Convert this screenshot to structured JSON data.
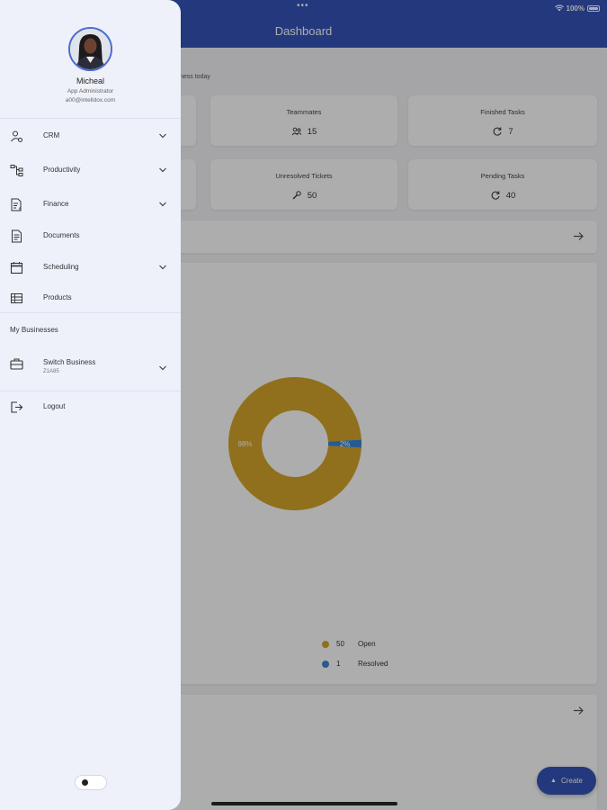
{
  "status_bar": {
    "battery": "100%"
  },
  "header": {
    "title": "Dashboard"
  },
  "dashboard": {
    "subtitle_fragment": "ness today",
    "stats": [
      {
        "label": "Teammates",
        "value": "15",
        "icon": "users-icon"
      },
      {
        "label": "Finished Tasks",
        "value": "7",
        "icon": "refresh-icon"
      },
      {
        "label": "Unresolved Tickets",
        "value": "50",
        "icon": "wrench-icon"
      },
      {
        "label": "Pending Tasks",
        "value": "40",
        "icon": "refresh-icon"
      }
    ],
    "chart_data": {
      "type": "pie",
      "donut": true,
      "slices": [
        {
          "label": "Open",
          "value": 50,
          "percent_label": "98%",
          "color": "#d4a62a"
        },
        {
          "label": "Resolved",
          "value": 1,
          "percent_label": "2%",
          "color": "#3a86d4"
        }
      ],
      "legend_position": "bottom"
    },
    "legend": [
      {
        "count": "50",
        "label": "Open",
        "color": "#d4a62a"
      },
      {
        "count": "1",
        "label": "Resolved",
        "color": "#3a86d4"
      }
    ]
  },
  "fab": {
    "label": "Create"
  },
  "drawer": {
    "user": {
      "name": "Micheal",
      "role": "App Administrator",
      "email": "a00@intelldox.com"
    },
    "menu": [
      {
        "label": "CRM",
        "icon": "crm-icon",
        "expandable": true
      },
      {
        "label": "Productivity",
        "icon": "productivity-icon",
        "expandable": true
      },
      {
        "label": "Finance",
        "icon": "finance-icon",
        "expandable": true
      },
      {
        "label": "Documents",
        "icon": "document-icon",
        "expandable": false
      },
      {
        "label": "Scheduling",
        "icon": "calendar-icon",
        "expandable": true
      },
      {
        "label": "Products",
        "icon": "table-icon",
        "expandable": false
      }
    ],
    "businesses": {
      "section_title": "My Businesses",
      "switch_label": "Switch Business",
      "switch_sub": "Z1A85"
    },
    "logout_label": "Logout"
  },
  "colors": {
    "primary": "#3653b8",
    "drawer_bg": "#eef1fa",
    "open": "#d4a62a",
    "resolved": "#3a86d4"
  }
}
